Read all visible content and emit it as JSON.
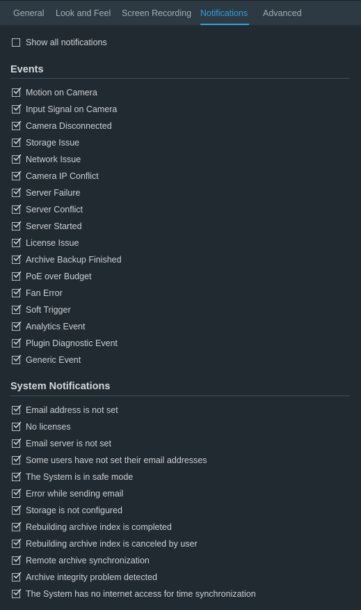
{
  "tabs": [
    {
      "label": "General"
    },
    {
      "label": "Look and Feel"
    },
    {
      "label": "Screen Recording"
    },
    {
      "label": "Notifications",
      "active": true
    },
    {
      "label": "Advanced"
    }
  ],
  "accent": "#2fa2db",
  "show_all": {
    "label": "Show all notifications",
    "checked": false
  },
  "events": {
    "title": "Events",
    "items": [
      "Motion on Camera",
      "Input Signal on Camera",
      "Camera Disconnected",
      "Storage Issue",
      "Network Issue",
      "Camera IP Conflict",
      "Server Failure",
      "Server Conflict",
      "Server Started",
      "License Issue",
      "Archive Backup Finished",
      "PoE over Budget",
      "Fan Error",
      "Soft Trigger",
      "Analytics Event",
      "Plugin Diagnostic Event",
      "Generic Event"
    ]
  },
  "system": {
    "title": "System Notifications",
    "items": [
      "Email address is not set",
      "No licenses",
      "Email server is not set",
      "Some users have not set their email addresses",
      "The System is in safe mode",
      "Error while sending email",
      "Storage is not configured",
      "Rebuilding archive index is completed",
      "Rebuilding archive index is canceled by user",
      "Remote archive synchronization",
      "Archive integrity problem detected",
      "The System has no internet access for time synchronization"
    ]
  }
}
